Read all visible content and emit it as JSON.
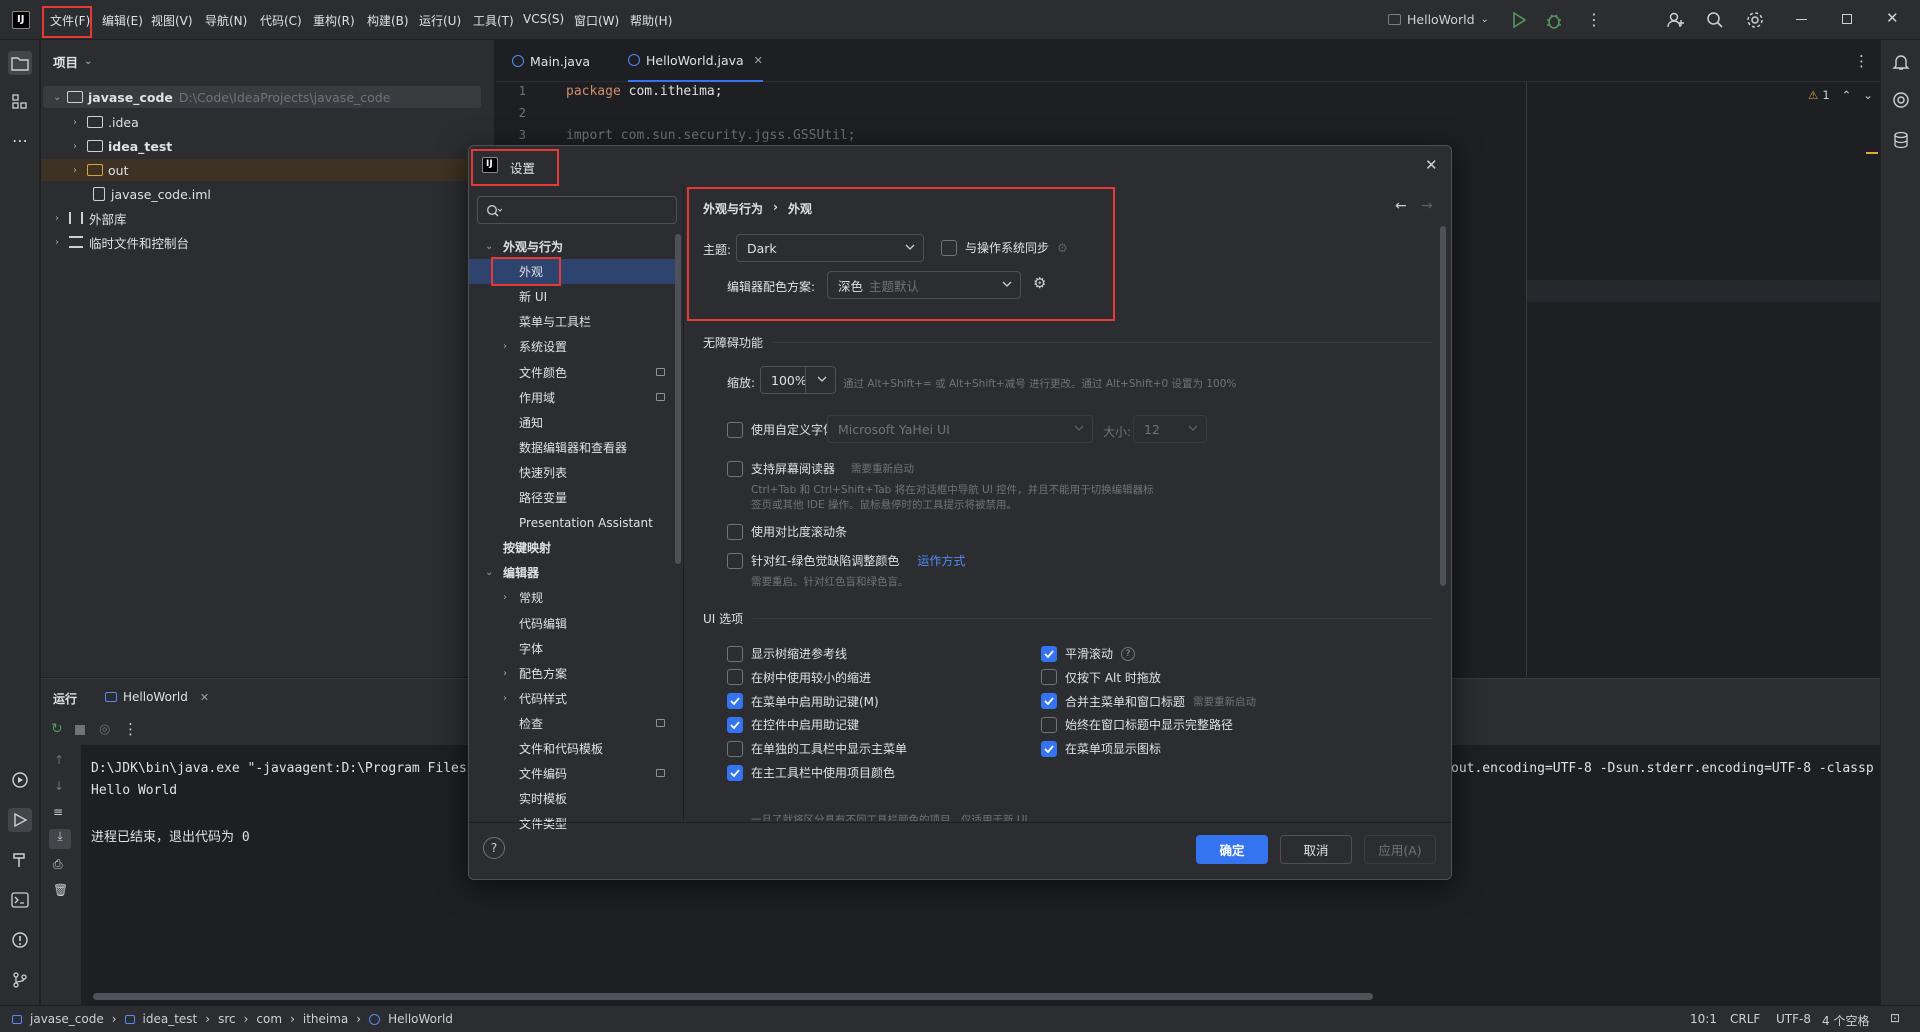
{
  "window": {
    "menu": [
      "文件(F)",
      "编辑(E)",
      "视图(V)",
      "导航(N)",
      "代码(C)",
      "重构(R)",
      "构建(B)",
      "运行(U)",
      "工具(T)",
      "VCS(S)",
      "窗口(W)",
      "帮助(H)"
    ],
    "run_config": "HelloWorld"
  },
  "project": {
    "header": "项目",
    "root_name": "javase_code",
    "root_path": "D:\\Code\\IdeaProjects\\javase_code",
    "items": [
      ".idea",
      "idea_test",
      "out",
      "javase_code.iml"
    ],
    "external_libs": "外部库",
    "scratches": "临时文件和控制台"
  },
  "editor": {
    "tabs": [
      "Main.java",
      "HelloWorld.java"
    ],
    "line_numbers": [
      "1",
      "2",
      "3"
    ],
    "code_line1_kw": "package",
    "code_line1_rest": " com.itheima;",
    "code_line3": "import com.sun.security.jgss.GSSUtil;",
    "warning_count": "1"
  },
  "run": {
    "title": "运行",
    "tab": "HelloWorld",
    "cmd_left": "D:\\JDK\\bin\\java.exe \"-javaagent:D:\\Program Files",
    "cmd_right": "out.encoding=UTF-8 -Dsun.stderr.encoding=UTF-8 -classp",
    "output": "Hello World",
    "exit": "进程已结束，退出代码为 0"
  },
  "status": {
    "breadcrumbs": [
      "javase_code",
      "idea_test",
      "src",
      "com",
      "itheima",
      "HelloWorld"
    ],
    "position": "10:1",
    "line_sep": "CRLF",
    "encoding": "UTF-8",
    "indent": "4 个空格"
  },
  "dialog": {
    "title": "设置",
    "search_placeholder": "",
    "nav": [
      {
        "label": "外观与行为",
        "level": 0,
        "expanded": true
      },
      {
        "label": "外观",
        "level": 1,
        "selected": true
      },
      {
        "label": "新 UI",
        "level": 1
      },
      {
        "label": "菜单与工具栏",
        "level": 1
      },
      {
        "label": "系统设置",
        "level": 1,
        "collapsible": true
      },
      {
        "label": "文件颜色",
        "level": 1,
        "badge": true
      },
      {
        "label": "作用域",
        "level": 1,
        "badge": true
      },
      {
        "label": "通知",
        "level": 1
      },
      {
        "label": "数据编辑器和查看器",
        "level": 1
      },
      {
        "label": "快速列表",
        "level": 1
      },
      {
        "label": "路径变量",
        "level": 1
      },
      {
        "label": "Presentation Assistant",
        "level": 1
      },
      {
        "label": "按键映射",
        "level": 0
      },
      {
        "label": "编辑器",
        "level": 0,
        "expanded": true
      },
      {
        "label": "常规",
        "level": 1,
        "collapsible": true
      },
      {
        "label": "代码编辑",
        "level": 1
      },
      {
        "label": "字体",
        "level": 1
      },
      {
        "label": "配色方案",
        "level": 1,
        "collapsible": true
      },
      {
        "label": "代码样式",
        "level": 1,
        "collapsible": true
      },
      {
        "label": "检查",
        "level": 1,
        "badge": true
      },
      {
        "label": "文件和代码模板",
        "level": 1
      },
      {
        "label": "文件编码",
        "level": 1,
        "badge": true
      },
      {
        "label": "实时模板",
        "level": 1
      },
      {
        "label": "文件类型",
        "level": 1
      }
    ],
    "breadcrumb_parent": "外观与行为",
    "breadcrumb_current": "外观",
    "theme_label": "主题:",
    "theme_value": "Dark",
    "sync_os": "与操作系统同步",
    "scheme_label": "编辑器配色方案:",
    "scheme_value": "深色",
    "scheme_hint": "主题默认",
    "accessibility": "无障碍功能",
    "zoom_label": "缩放:",
    "zoom_value": "100%",
    "zoom_hint": "通过 Alt+Shift+= 或 Alt+Shift+减号 进行更改。通过 Alt+Shift+0 设置为 100%",
    "custom_font": "使用自定义字体:",
    "font_value": "Microsoft YaHei UI",
    "size_label": "大小:",
    "size_value": "12",
    "screen_reader": "支持屏幕阅读器",
    "restart_required": "需要重新启动",
    "screen_reader_hint1": "Ctrl+Tab 和 Ctrl+Shift+Tab 将在对话框中导航 UI 控件，并且不能用于切换编辑器标",
    "screen_reader_hint2": "签页或其他 IDE 操作。鼠标悬停时的工具提示将被禁用。",
    "contrast_scrollbars": "使用对比度滚动条",
    "color_deficiency": "针对红-绿色觉缺陷调整颜色",
    "how_it_works": "运作方式",
    "color_hint": "需要重启。针对红色盲和绿色盲。",
    "ui_options": "UI 选项",
    "options_left": [
      {
        "label": "显示树缩进参考线",
        "checked": false
      },
      {
        "label": "在树中使用较小的缩进",
        "checked": false
      },
      {
        "label": "在菜单中启用助记键(M)",
        "checked": true
      },
      {
        "label": "在控件中启用助记键",
        "checked": true
      },
      {
        "label": "在单独的工具栏中显示主菜单",
        "checked": false
      },
      {
        "label": "在主工具栏中使用项目颜色",
        "checked": true
      }
    ],
    "options_right": [
      {
        "label": "平滑滚动",
        "checked": true
      },
      {
        "label": "仅按下 Alt 时拖放",
        "checked": false
      },
      {
        "label": "合并主菜单和窗口标题",
        "checked": true,
        "hint": "需要重新启动"
      },
      {
        "label": "始终在窗口标题中显示完整路径",
        "checked": false
      },
      {
        "label": "在菜单项显示图标",
        "checked": true
      }
    ],
    "cut_hint": "一旦了就将区分具有不同工具栏颜色的项目，仅适用于新 UI",
    "ok": "确定",
    "cancel": "取消",
    "apply": "应用(A)",
    "help": "?"
  },
  "colors": {
    "accent": "#3574f0",
    "highlight_box": "#e53935",
    "keyword": "#cf8e6d"
  }
}
